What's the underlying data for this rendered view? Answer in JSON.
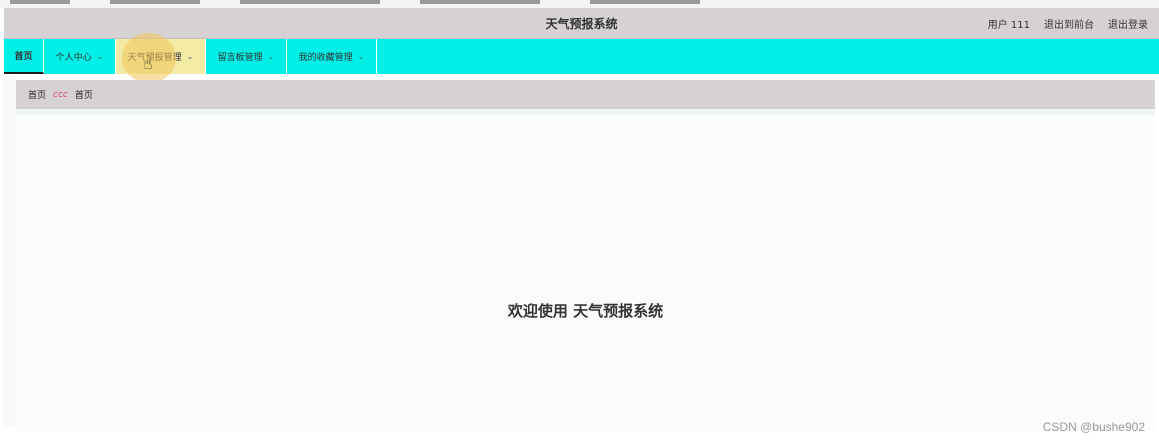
{
  "header": {
    "title": "天气预报系统",
    "user_label": "用户 111",
    "front_label": "退出到前台",
    "logout_label": "退出登录"
  },
  "nav": {
    "items": [
      {
        "label": "首页"
      },
      {
        "label": "个人中心"
      },
      {
        "label": "天气预报管理"
      },
      {
        "label": "留言板管理"
      },
      {
        "label": "我的收藏管理"
      }
    ]
  },
  "breadcrumb": {
    "root": "首页",
    "separator": "ccc",
    "current": "首页"
  },
  "main": {
    "welcome": "欢迎使用 天气预报系统"
  },
  "watermark": "CSDN @bushe902",
  "colors": {
    "header_bg": "#d6d2d3",
    "nav_bg": "#00efe6",
    "active_nav_bg": "#f2eaa5"
  }
}
